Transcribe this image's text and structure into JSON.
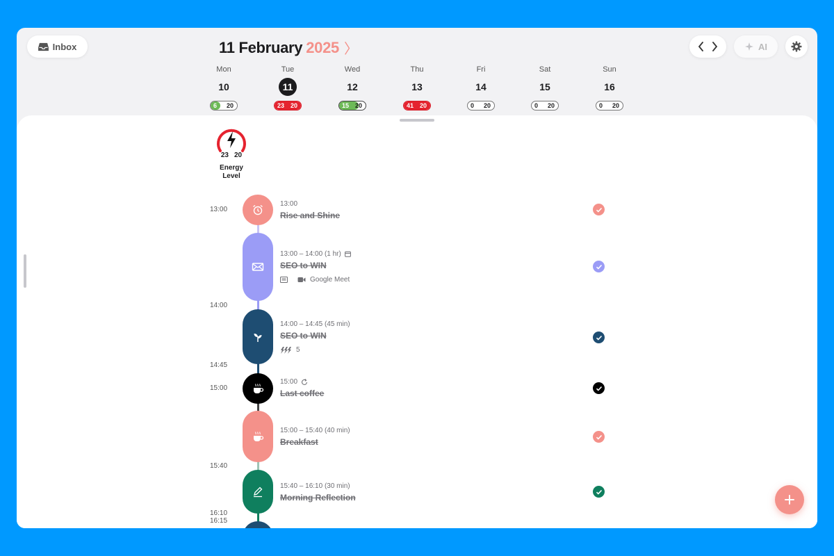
{
  "header": {
    "inbox_label": "Inbox",
    "date_day_month": "11 February",
    "date_year": "2025",
    "ai_label": "AI"
  },
  "week": [
    {
      "weekday": "Mon",
      "date": "10",
      "energy_used": "6",
      "energy_cap": "20",
      "status": "green-partial",
      "selected": false
    },
    {
      "weekday": "Tue",
      "date": "11",
      "energy_used": "23",
      "energy_cap": "20",
      "status": "over",
      "selected": true
    },
    {
      "weekday": "Wed",
      "date": "12",
      "energy_used": "15",
      "energy_cap": "20",
      "status": "green",
      "selected": false
    },
    {
      "weekday": "Thu",
      "date": "13",
      "energy_used": "41",
      "energy_cap": "20",
      "status": "over",
      "selected": false
    },
    {
      "weekday": "Fri",
      "date": "14",
      "energy_used": "0",
      "energy_cap": "20",
      "status": "empty",
      "selected": false
    },
    {
      "weekday": "Sat",
      "date": "15",
      "energy_used": "0",
      "energy_cap": "20",
      "status": "empty",
      "selected": false
    },
    {
      "weekday": "Sun",
      "date": "16",
      "energy_used": "0",
      "energy_cap": "20",
      "status": "empty",
      "selected": false
    }
  ],
  "energy": {
    "used": "23",
    "cap": "20",
    "label_line1": "Energy",
    "label_line2": "Level",
    "color": "#e5232f"
  },
  "time_labels": [
    "13:00",
    "14:00",
    "14:45",
    "15:00",
    "15:40",
    "16:10",
    "16:15"
  ],
  "tasks": [
    {
      "time_meta": "13:00",
      "title": "Rise and Shine",
      "icon": "alarm-clock-icon",
      "color": "#f4918a",
      "done": true
    },
    {
      "time_meta": "13:00 – 14:00 (1 hr)",
      "title": "SEO to WIN",
      "icon": "mail-icon",
      "color": "#9b9cf6",
      "done": true,
      "extra_label": "Google Meet"
    },
    {
      "time_meta": "14:00 – 14:45 (45 min)",
      "title": "SEO to WIN",
      "icon": "sprout-icon",
      "color": "#1e4d72",
      "done": true,
      "energy_value": "5"
    },
    {
      "time_meta": "15:00",
      "title": "Last coffee",
      "icon": "coffee-icon",
      "color": "#000000",
      "done": true,
      "repeat": true
    },
    {
      "time_meta": "15:00 – 15:40 (40 min)",
      "title": "Breakfast",
      "icon": "coffee-icon",
      "color": "#f4918a",
      "done": true
    },
    {
      "time_meta": "15:40 – 16:10 (30 min)",
      "title": "Morning Reflection",
      "icon": "pencil-icon",
      "color": "#0f7f5e",
      "done": true
    }
  ],
  "colors": {
    "accent": "#f4918a",
    "background": "#0099ff"
  }
}
